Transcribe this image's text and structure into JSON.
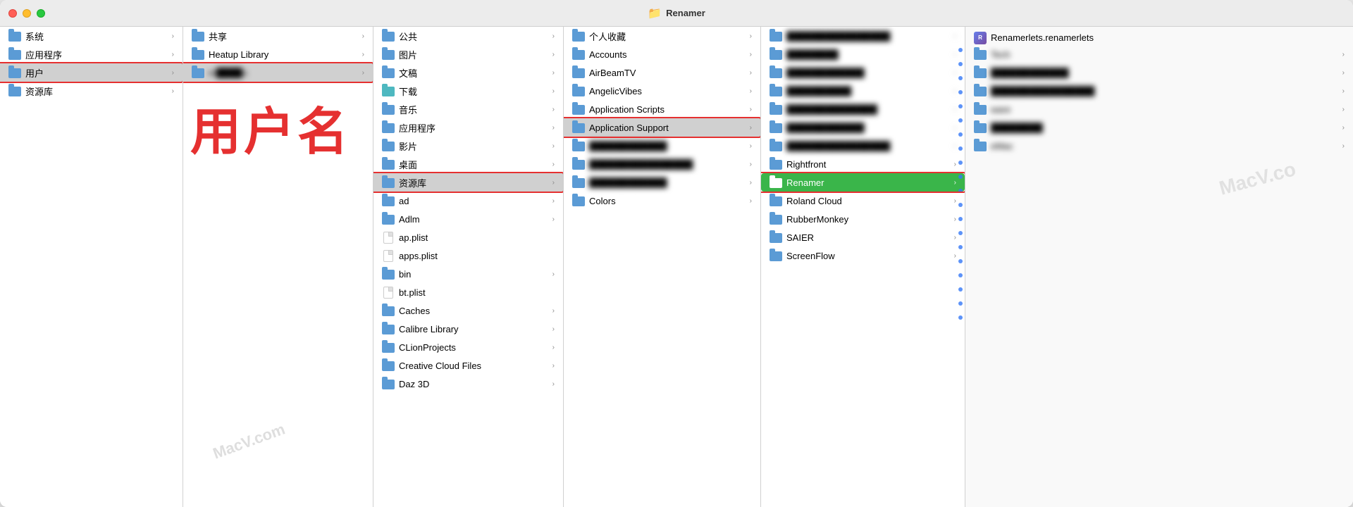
{
  "window": {
    "title": "Renamer",
    "title_icon": "📁"
  },
  "col1": {
    "items": [
      {
        "id": "system",
        "label": "系统",
        "type": "folder",
        "has_chevron": true
      },
      {
        "id": "apps",
        "label": "应用程序",
        "type": "folder",
        "has_chevron": true
      },
      {
        "id": "users",
        "label": "用户",
        "type": "folder",
        "has_chevron": true,
        "selected": true
      },
      {
        "id": "library",
        "label": "资源库",
        "type": "folder",
        "has_chevron": true
      }
    ]
  },
  "col2": {
    "items": [
      {
        "id": "shared",
        "label": "共享",
        "type": "folder",
        "has_chevron": true
      },
      {
        "id": "heatup",
        "label": "Heatup Library",
        "type": "folder",
        "has_chevron": true
      },
      {
        "id": "username",
        "label": "m___n",
        "type": "folder",
        "has_chevron": true,
        "selected": true,
        "blurred": true
      }
    ],
    "watermark": "MacV.com"
  },
  "col3": {
    "items": [
      {
        "id": "public",
        "label": "公共",
        "type": "folder",
        "has_chevron": true
      },
      {
        "id": "pictures",
        "label": "图片",
        "type": "folder",
        "has_chevron": true
      },
      {
        "id": "documents",
        "label": "文稿",
        "type": "folder",
        "has_chevron": true
      },
      {
        "id": "downloads",
        "label": "下载",
        "type": "folder",
        "has_chevron": true,
        "icon_color": "teal"
      },
      {
        "id": "music",
        "label": "音乐",
        "type": "folder",
        "has_chevron": true
      },
      {
        "id": "apps2",
        "label": "应用程序",
        "type": "folder",
        "has_chevron": true
      },
      {
        "id": "movies",
        "label": "影片",
        "type": "folder",
        "has_chevron": true
      },
      {
        "id": "desktop",
        "label": "桌面",
        "type": "folder",
        "has_chevron": true
      },
      {
        "id": "library2",
        "label": "资源库",
        "type": "folder",
        "has_chevron": true,
        "selected": true
      },
      {
        "id": "ad",
        "label": "ad",
        "type": "folder",
        "has_chevron": true
      },
      {
        "id": "adlm",
        "label": "Adlm",
        "type": "folder",
        "has_chevron": true
      },
      {
        "id": "applist",
        "label": "ap.plist",
        "type": "file",
        "has_chevron": false
      },
      {
        "id": "appslist",
        "label": "apps.plist",
        "type": "file",
        "has_chevron": false
      },
      {
        "id": "bin",
        "label": "bin",
        "type": "folder",
        "has_chevron": true
      },
      {
        "id": "btplist",
        "label": "bt.plist",
        "type": "file",
        "has_chevron": false
      },
      {
        "id": "caches",
        "label": "Caches",
        "type": "folder",
        "has_chevron": true
      },
      {
        "id": "calibre",
        "label": "Calibre Library",
        "type": "folder",
        "has_chevron": true
      },
      {
        "id": "clion",
        "label": "CLionProjects",
        "type": "folder",
        "has_chevron": true
      },
      {
        "id": "creative",
        "label": "Creative Cloud Files",
        "type": "folder",
        "has_chevron": true
      },
      {
        "id": "daz3d",
        "label": "Daz 3D",
        "type": "folder",
        "has_chevron": true
      }
    ]
  },
  "col4": {
    "items": [
      {
        "id": "fav",
        "label": "个人收藏",
        "type": "folder",
        "has_chevron": true
      },
      {
        "id": "accounts",
        "label": "Accounts",
        "type": "folder",
        "has_chevron": true
      },
      {
        "id": "airbeam",
        "label": "AirBeamTV",
        "type": "folder",
        "has_chevron": true
      },
      {
        "id": "angelic",
        "label": "AngelicVibes",
        "type": "folder",
        "has_chevron": true
      },
      {
        "id": "appscripts",
        "label": "Application Scripts",
        "type": "folder",
        "has_chevron": true
      },
      {
        "id": "appsupport",
        "label": "Application Support",
        "type": "folder",
        "has_chevron": true,
        "selected": true
      },
      {
        "id": "blurred1",
        "label": "████",
        "type": "folder",
        "has_chevron": true,
        "blurred": true
      },
      {
        "id": "blurred2",
        "label": "████████",
        "type": "folder",
        "has_chevron": true,
        "blurred": true
      },
      {
        "id": "blurred3",
        "label": "██████",
        "type": "folder",
        "has_chevron": true,
        "blurred": true
      },
      {
        "id": "colors",
        "label": "Colors",
        "type": "folder",
        "has_chevron": true
      }
    ]
  },
  "col5": {
    "items": [
      {
        "id": "c5_1",
        "label": "████████████",
        "type": "folder",
        "has_chevron": true,
        "blurred": true
      },
      {
        "id": "c5_2",
        "label": "████",
        "type": "folder",
        "has_chevron": true,
        "blurred": true
      },
      {
        "id": "c5_3",
        "label": "████████",
        "type": "folder",
        "has_chevron": true,
        "blurred": true
      },
      {
        "id": "c5_4",
        "label": "██████",
        "type": "folder",
        "has_chevron": true,
        "blurred": true
      },
      {
        "id": "c5_5",
        "label": "███████████",
        "type": "folder",
        "has_chevron": true,
        "blurred": true
      },
      {
        "id": "c5_6",
        "label": "████████",
        "type": "folder",
        "has_chevron": true,
        "blurred": true
      },
      {
        "id": "c5_7",
        "label": "████████████",
        "type": "folder",
        "has_chevron": true,
        "blurred": true
      },
      {
        "id": "rightfont",
        "label": "Rightfront",
        "type": "folder",
        "has_chevron": true
      },
      {
        "id": "renamer",
        "label": "Renamer",
        "type": "folder",
        "has_chevron": true,
        "selected_green": true
      },
      {
        "id": "roland",
        "label": "Roland Cloud",
        "type": "folder",
        "has_chevron": true
      },
      {
        "id": "rubber",
        "label": "RubberMonkey",
        "type": "folder",
        "has_chevron": true
      },
      {
        "id": "saier",
        "label": "SAIER",
        "type": "folder",
        "has_chevron": true
      },
      {
        "id": "screenflow",
        "label": "ScreenFlow",
        "type": "folder",
        "has_chevron": true
      }
    ]
  },
  "col6": {
    "items": [
      {
        "id": "renamerlets",
        "label": "Renamerlets.renamerlets",
        "type": "app"
      },
      {
        "id": "c6_tech",
        "label": "Tech",
        "type": "folder",
        "blurred": true
      },
      {
        "id": "c6_watermark",
        "label": "MacV.com",
        "type": "watermark"
      },
      {
        "id": "c6_ware",
        "label": "ware",
        "type": "folder",
        "blurred": true
      },
      {
        "id": "c6_emac",
        "label": "eMac",
        "type": "folder",
        "blurred": true
      }
    ],
    "watermark": "MacV.co"
  },
  "highlights": {
    "users_box": "col1 users item",
    "username_box": "col2 username item",
    "library_box": "col3 library item",
    "appsupport_box": "col4 appsupport item",
    "renamer_box": "col5 renamer item"
  },
  "big_label": "用户名",
  "watermark_text": "MacV.com"
}
